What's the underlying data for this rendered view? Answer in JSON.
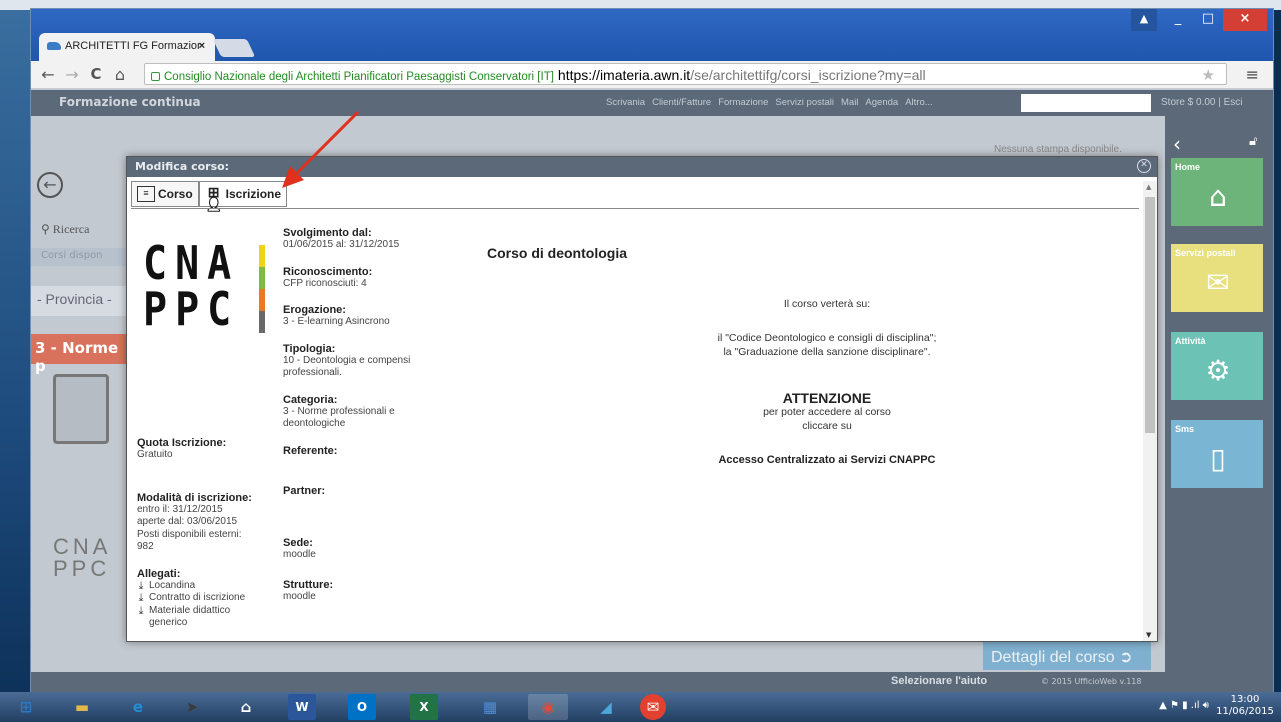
{
  "browser": {
    "tab_title": "ARCHITETTI FG Formazior",
    "tab_close": "×",
    "org_label": "Consiglio Nazionale degli Architetti Pianificatori Paesaggisti Conservatori [IT]",
    "url_host": "https://imateria.awn.it",
    "url_path": "/se/architettifg/corsi_iscrizione?my=all",
    "back": "←",
    "forward": "→",
    "reload": "C",
    "home": "⌂",
    "star": "★",
    "menu": "≡",
    "minimize": "_",
    "maximize": "□",
    "close": "×",
    "user": "▲"
  },
  "app": {
    "title": "Formazione continua",
    "menu": [
      "Scrivania",
      "Clienti/Fatture",
      "Formazione",
      "Servizi postali",
      "Mail",
      "Agenda",
      "Altro..."
    ],
    "store": "Store $ 0.00 | Esci",
    "no_print": "Nessuna stampa disponibile.",
    "search_label": "Ricerca",
    "corsi_label": "Corsi dispon",
    "province_placeholder": "- Provincia -",
    "category_banner": "3 - Norme p",
    "details_button": "Dettagli del corso",
    "help_text": "Selezionare l'aiuto",
    "copyright": "© 2015 UfficioWeb v.118",
    "ghost_logo": "CNA PPC"
  },
  "sidebar": {
    "tiles": [
      {
        "label": "Home",
        "color": "#6db47a",
        "icon": "house-icon"
      },
      {
        "label": "Servizi postali",
        "color": "#e8df7e",
        "icon": "envelope-icon"
      },
      {
        "label": "Attività",
        "color": "#6cc2b4",
        "icon": "gears-icon"
      },
      {
        "label": "Sms",
        "color": "#7ab6d3",
        "icon": "phone-icon"
      }
    ]
  },
  "dialog": {
    "title": "Modifica corso:",
    "tabs": [
      "Corso",
      "Iscrizione"
    ],
    "logo_line1": "CNA",
    "logo_line2": "PPC",
    "logo_colors": [
      "#f2d11a",
      "#7ebb45",
      "#e97a23",
      "#6a6a6a"
    ],
    "quota_label": "Quota Iscrizione:",
    "quota_value": "Gratuito",
    "modalita_label": "Modalità di iscrizione:",
    "modalita_lines": [
      "entro il: 31/12/2015",
      "aperte dal: 03/06/2015",
      "Posti disponibili esterni:",
      "982"
    ],
    "allegati_label": "Allegati:",
    "allegati": [
      "Locandina",
      "Contratto di iscrizione",
      "Materiale didattico generico"
    ],
    "fields": [
      {
        "label": "Svolgimento dal:",
        "value": "01/06/2015 al: 31/12/2015"
      },
      {
        "label": "Riconoscimento:",
        "value": "CFP riconosciuti: 4"
      },
      {
        "label": "Erogazione:",
        "value": "3 - E-learning Asincrono"
      },
      {
        "label": "Tipologia:",
        "value": "10 - Deontologia e compensi professionali."
      },
      {
        "label": "Categoria:",
        "value": "3 - Norme professionali e deontologiche"
      },
      {
        "label": "Referente:",
        "value": ""
      },
      {
        "label": "Partner:",
        "value": ""
      },
      {
        "label": "Sede:",
        "value": "moodle"
      },
      {
        "label": "Strutture:",
        "value": "moodle"
      }
    ],
    "course_title": "Corso di deontologia",
    "desc_intro": "Il corso verterà su:",
    "desc_line1": "il \"Codice Deontologico e consigli di disciplina\";",
    "desc_line2": "la \"Graduazione della sanzione disciplinare\".",
    "attention_title": "ATTENZIONE",
    "attention_line1": "per poter accedere al corso",
    "attention_line2": "cliccare su",
    "access_text": "Accesso Centralizzato ai Servizi CNAPPC"
  },
  "taskbar": {
    "time": "13:00",
    "date": "11/06/2015",
    "apps": [
      {
        "name": "start",
        "color": "#2a79c9",
        "glyph": "⊞"
      },
      {
        "name": "explorer",
        "color": "#e3b94a",
        "glyph": "▬"
      },
      {
        "name": "ie",
        "color": "#1f8fd6",
        "glyph": "e"
      },
      {
        "name": "bird",
        "color": "#3a3a3a",
        "glyph": "➤"
      },
      {
        "name": "home",
        "color": "#ffffff",
        "glyph": "⌂"
      },
      {
        "name": "word",
        "color": "#2b579a",
        "glyph": "W"
      },
      {
        "name": "outlook",
        "color": "#0072c6",
        "glyph": "O"
      },
      {
        "name": "excel",
        "color": "#217346",
        "glyph": "X"
      },
      {
        "name": "control",
        "color": "#4d8fd8",
        "glyph": "▦"
      },
      {
        "name": "chrome",
        "color": "#e04a3a",
        "glyph": "◉"
      },
      {
        "name": "note",
        "color": "#4fa6d8",
        "glyph": "◢"
      },
      {
        "name": "mail",
        "color": "#e2412f",
        "glyph": "✉"
      }
    ]
  }
}
